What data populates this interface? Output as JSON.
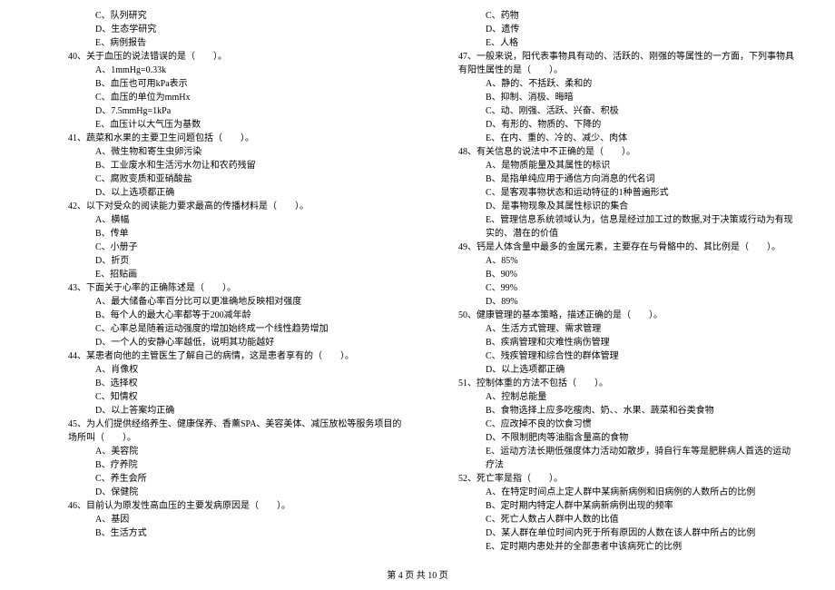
{
  "left": {
    "q39_options": [
      "C、队列研究",
      "D、生态学研究",
      "E、病例报告"
    ],
    "q40": "40、关于血压的说法错误的是（　　）。",
    "q40_options": [
      "A、1mmHg=0.33k",
      "B、血压也可用kPa表示",
      "C、血压的单位为mmHx",
      "D、7.5mmHg=1kPa",
      "E、血压计以大气压为基数"
    ],
    "q41": "41、蔬菜和水果的主要卫生问题包括（　　）。",
    "q41_options": [
      "A、微生物和寄生虫卵污染",
      "B、工业废水和生活污水勿让和农药残留",
      "C、腐败变质和亚硝酸盐",
      "D、以上选项都正确"
    ],
    "q42": "42、以下对受众的阅读能力要求最高的传播材料是（　　）。",
    "q42_options": [
      "A、横幅",
      "B、传单",
      "C、小册子",
      "D、折页",
      "E、招贴画"
    ],
    "q43": "43、下面关于心率的正确陈述是（　　）。",
    "q43_options": [
      "A、最大储备心率百分比可以更准确地反映相对强度",
      "B、每个人的最大心率都等于200减年龄",
      "C、心率总是随着运动强度的增加始终成一个线性趋势增加",
      "D、一个人的安静心率越低，说明其功能越好"
    ],
    "q44": "44、某患者向他的主管医生了解自己的病情，这是患者享有的（　　）。",
    "q44_options": [
      "A、肖像权",
      "B、选择权",
      "C、知情权",
      "D、以上答案均正确"
    ],
    "q45": "45、为人们提供经络养生、健康保养、香薰SPA、美容美体、减压放松等服务项目的场所叫（　　）。",
    "q45_options": [
      "A、美容院",
      "B、疗养院",
      "C、养生会所",
      "D、保健院"
    ],
    "q46": "46、目前认为原发性高血压的主要发病原因是（　　）。",
    "q46_options": [
      "A、基因",
      "B、生活方式"
    ]
  },
  "right": {
    "q46_options_cont": [
      "C、药物",
      "D、遗传",
      "E、人格"
    ],
    "q47": "47、一般来说，阳代表事物具有动的、活跃的、刚强的等属性的一方面，下列事物具有阳性属性的是（　　）。",
    "q47_options": [
      "A、静的、不括跃、柔和的",
      "B、抑制、消极、晦暗",
      "C、动、刚强、活跃、兴奋、积极",
      "D、有形的、物质的、下降的",
      "E、在内、重的、冷的、减少、肉体"
    ],
    "q48": "48、有关信息的说法中不正确的是（　　）。",
    "q48_options": [
      "A、是物质能量及其属性的标识",
      "B、是指单纯应用于通信方向消息的代名词",
      "C、是客观事物状态和运动特征的1种普遍形式",
      "D、是事物现象及其属性标识的集合",
      "E、管理信息系统领域认为，信息是经过加工过的数据,对于决策或行动为有现实的、潜在的价值"
    ],
    "q49": "49、钙是人体含量中最多的金属元素，主要存在与骨骼中的、其比例是（　　）。",
    "q49_options": [
      "A、85%",
      "B、90%",
      "C、99%",
      "D、89%"
    ],
    "q50": "50、健康管理的基本策略，描述正确的是（　　）。",
    "q50_options": [
      "A、生活方式管理、需求管理",
      "B、疾病管理和灾难性病伤管理",
      "C、残疾管理和综合性的群体管理",
      "D、以上选项都正确"
    ],
    "q51": "51、控制体重的方法不包括（　　）。",
    "q51_options": [
      "A、控制总能量",
      "B、食物选择上应多吃瘦肉、奶、、水果、蔬菜和谷类食物",
      "C、应改掉不良的饮食习惯",
      "D、不限制肥肉等油脂含量高的食物",
      "E、运动方法长期低强度体力活动如散步，骑自行车等是肥胖病人首选的运动疗法"
    ],
    "q52": "52、死亡率是指（　　）。",
    "q52_options": [
      "A、在特定时间点上定人群中某病新病例和旧病例的人数所占的比例",
      "B、定时期内特定人群中某病新病例出现的频率",
      "C、死亡人数占人群中人数的比值",
      "D、某人群在单位时间内死于所有原因的人数在该人群中所占的比例",
      "E、定时期内患处并的全部患者中该病死亡的比例"
    ]
  },
  "footer": "第 4 页 共 10 页"
}
